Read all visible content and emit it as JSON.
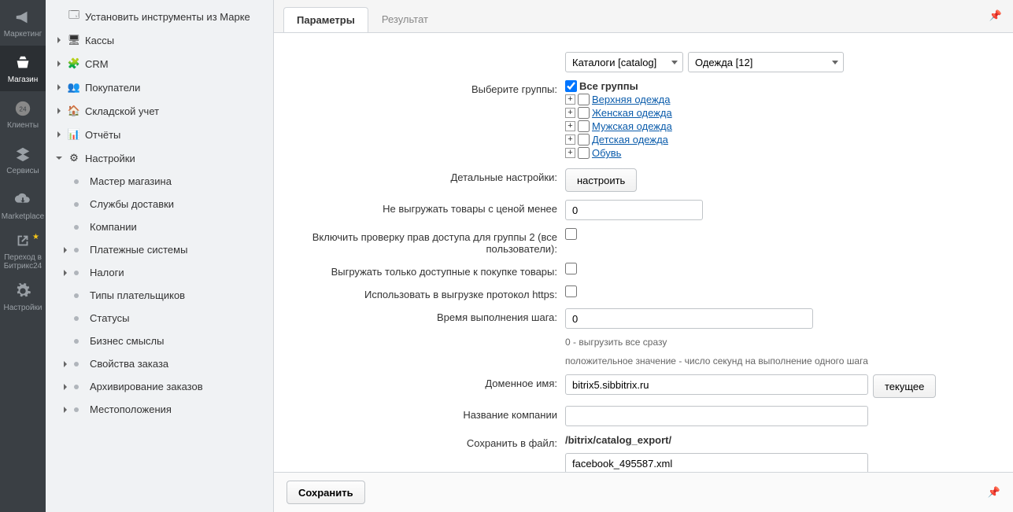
{
  "rail": {
    "items": [
      {
        "label": "Маркетинг"
      },
      {
        "label": "Магазин"
      },
      {
        "label": "Клиенты",
        "badge": "24"
      },
      {
        "label": "Сервисы"
      },
      {
        "label": "Marketplace"
      },
      {
        "label": "Переход в Битрикс24"
      },
      {
        "label": "Настройки"
      }
    ]
  },
  "tree": {
    "items": [
      {
        "label": "Установить инструменты из Марке",
        "icon": "app"
      },
      {
        "label": "Кассы",
        "icon": "cash"
      },
      {
        "label": "CRM",
        "icon": "crm"
      },
      {
        "label": "Покупатели",
        "icon": "users"
      },
      {
        "label": "Складской учет",
        "icon": "box"
      },
      {
        "label": "Отчёты",
        "icon": "chart"
      },
      {
        "label": "Настройки",
        "icon": "gear",
        "expanded": true,
        "children": [
          {
            "label": "Мастер магазина"
          },
          {
            "label": "Службы доставки"
          },
          {
            "label": "Компании"
          },
          {
            "label": "Платежные системы",
            "arrow": true
          },
          {
            "label": "Налоги",
            "arrow": true
          },
          {
            "label": "Типы плательщиков"
          },
          {
            "label": "Статусы"
          },
          {
            "label": "Бизнес смыслы"
          },
          {
            "label": "Свойства заказа",
            "arrow": true
          },
          {
            "label": "Архивирование заказов",
            "arrow": true
          },
          {
            "label": "Местоположения",
            "arrow": true
          }
        ]
      }
    ]
  },
  "tabs": {
    "active": "Параметры",
    "inactive": "Результат"
  },
  "form": {
    "catalog_select": "Каталоги [catalog]",
    "item_select": "Одежда [12]",
    "groups_label": "Выберите группы:",
    "all_groups": "Все группы",
    "group_items": [
      "Верхняя одежда",
      "Женская одежда",
      "Мужская одежда",
      "Детская одежда",
      "Обувь"
    ],
    "detail_label": "Детальные настройки:",
    "configure_btn": "настроить",
    "min_price_label": "Не выгружать товары с ценой менее",
    "min_price_value": "0",
    "group2_label": "Включить проверку прав доступа для группы 2 (все пользователи):",
    "only_available_label": "Выгружать только доступные к покупке товары:",
    "https_label": "Использовать в выгрузке протокол https:",
    "step_time_label": "Время выполнения шага:",
    "step_time_value": "0",
    "step_hint1": "0 - выгрузить все сразу",
    "step_hint2": "положительное значение - число секунд на выполнение одного шага",
    "domain_label": "Доменное имя:",
    "domain_value": "bitrix5.sibbitrix.ru",
    "current_btn": "текущее",
    "company_label": "Название компании",
    "company_value": "",
    "save_file_label": "Сохранить в файл:",
    "save_path": "/bitrix/catalog_export/",
    "save_file_value": "facebook_495587.xml"
  },
  "footer": {
    "save": "Сохранить"
  }
}
